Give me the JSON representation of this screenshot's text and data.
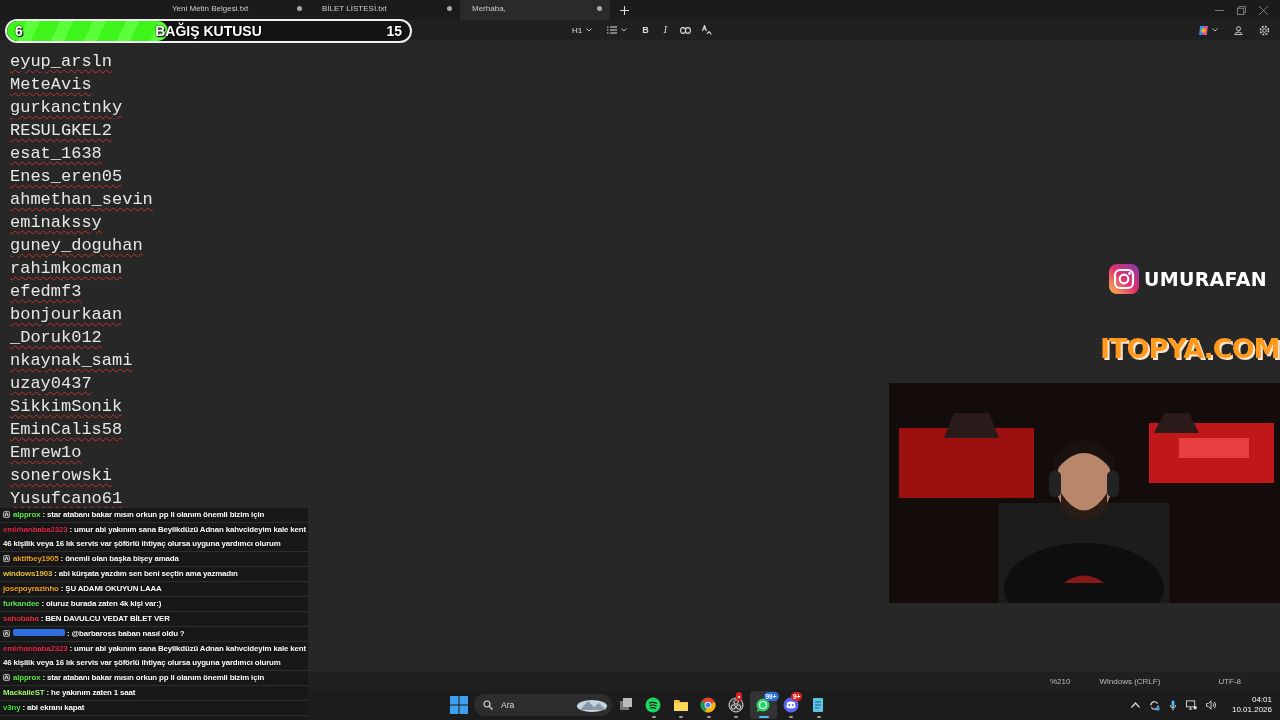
{
  "donation": {
    "current": "6",
    "title": "BAĞIŞ KUTUSU",
    "goal": "15",
    "level": 0.4
  },
  "tabs": [
    {
      "label": "Yeni Metin Belgesi.txt",
      "selected": false,
      "modified": true
    },
    {
      "label": "BİLET LİSTESİ.txt",
      "selected": false,
      "modified": true
    },
    {
      "label": "Merhaba,",
      "selected": true,
      "modified": true
    }
  ],
  "toolbar": [
    {
      "kind": "heading",
      "label": "H1"
    },
    {
      "kind": "list"
    },
    {
      "kind": "bold",
      "label": "B"
    },
    {
      "kind": "italic",
      "label": "I"
    },
    {
      "kind": "link"
    },
    {
      "kind": "spell"
    }
  ],
  "editor": {
    "lines": [
      "eyup_arsln",
      "MeteAvis",
      "gurkanctnky",
      "RESULGKEL2",
      "esat_1638",
      "Enes_eren05",
      "ahmethan_sevin",
      "eminakssy",
      "guney_doguhan",
      "rahimkocman",
      "efedmf3",
      "bonjourkaan",
      "_Doruk012",
      "nkaynak_sami",
      "uzay0437",
      "SikkimSonik",
      "EminCalis58",
      "Emrew1o",
      "sonerowski",
      "Yusufcano61"
    ]
  },
  "chat": [
    {
      "user": "alpprox",
      "color": "#5ee84a",
      "badge": true,
      "text": ": star atabanı bakar mısın orkun pp li olanım önemli bizim için"
    },
    {
      "user": "emirhanbaba2323",
      "color": "#e0284a",
      "badge": false,
      "text": ": umur abi yakınım sana Beylikdüzü Adnan kahvcideyim kale kent 46 kişilik veya 16 lık servis var şöförlü ihtiyaç olursa uyguna yardımcı olurum"
    },
    {
      "user": "aktifbey1905",
      "color": "#e8a020",
      "badge": true,
      "text": ": önemli olan başka bişey amada"
    },
    {
      "user": "windows1903",
      "color": "#e8c040",
      "badge": false,
      "text": ": abi kürşata yazdım sen beni seçtin ama yazmadın"
    },
    {
      "user": "josepoyrazinho",
      "color": "#f0a020",
      "badge": false,
      "text": ": ŞU ADAMI OKUYUN LAAA"
    },
    {
      "user": "furkandee",
      "color": "#60e060",
      "badge": false,
      "text": ": oluruz burada zaten 4k kişi var:)"
    },
    {
      "user": "sahobaba",
      "color": "#e03040",
      "badge": false,
      "text": ": BEN DAVULCU VEDAT BİLET VER"
    },
    {
      "color": "#3070e0",
      "badge": true,
      "text": ": @barbaross baban nasıl oldu ?"
    },
    {
      "user": "emirhanbaba2323",
      "color": "#e0284a",
      "badge": false,
      "text": ": umur abi yakınım sana Beylikdüzü Adnan kahvcideyim kale kent 46 kişilik veya 16 lık servis var şöförlü ihtiyaç olursa uyguna yardımcı olurum"
    },
    {
      "user": "alpprox",
      "color": "#5ee84a",
      "badge": true,
      "text": ": star atabanı bakar mısın orkun pp li olanım önemli bizim için"
    },
    {
      "user": "MackalieST",
      "color": "#a0f070",
      "badge": false,
      "text": ": he yakınım zaten 1 saat"
    },
    {
      "user": "v3ny",
      "color": "#40e040",
      "badge": false,
      "text": ": abi ekranı kapat"
    }
  ],
  "overlay": {
    "instagram": "UMURAFAN",
    "sponsor": "ITOPYA.COM"
  },
  "status_bar": {
    "zoom": "%210",
    "line_ending": "Windows (CRLF)",
    "encoding": "UTF-8"
  },
  "taskbar": {
    "search_placeholder": "Ara",
    "apps": [
      {
        "kind": "taskview",
        "running": false,
        "selected": false
      },
      {
        "kind": "spotify",
        "running": true,
        "selected": false
      },
      {
        "kind": "files",
        "running": true,
        "selected": false
      },
      {
        "kind": "chrome",
        "running": true,
        "selected": false
      },
      {
        "kind": "obs",
        "running": true,
        "selected": false,
        "badge": "•"
      },
      {
        "kind": "whatsapp",
        "running": true,
        "selected": true,
        "badge": "99+"
      },
      {
        "kind": "discord",
        "running": true,
        "selected": false,
        "badge": "9+"
      },
      {
        "kind": "notepad",
        "running": true,
        "selected": false
      }
    ],
    "time": "04:01",
    "date": "10.01.2026"
  }
}
